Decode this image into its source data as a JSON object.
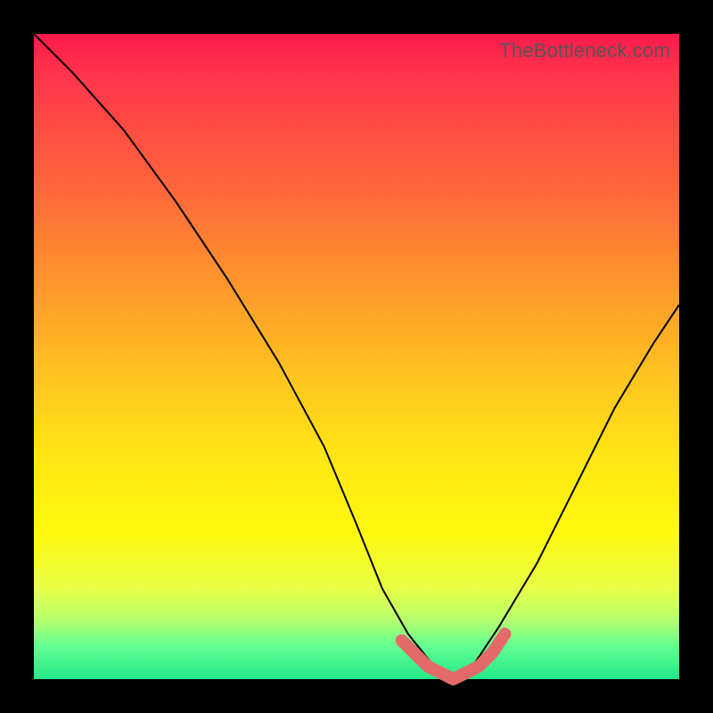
{
  "watermark": "TheBottleneck.com",
  "colors": {
    "background": "#000000",
    "curve": "#000000",
    "marker": "#e46a6a",
    "gradient_top": "#ff1a4d",
    "gradient_bottom": "#24e88a"
  },
  "chart_data": {
    "type": "line",
    "title": "",
    "xlabel": "",
    "ylabel": "",
    "xlim": [
      0,
      100
    ],
    "ylim": [
      0,
      100
    ],
    "series": [
      {
        "name": "bottleneck-curve",
        "x": [
          0,
          6,
          14,
          22,
          30,
          38,
          45,
          50,
          54,
          58,
          62,
          65,
          68,
          72,
          78,
          84,
          90,
          96,
          100
        ],
        "y": [
          100,
          94,
          85,
          74,
          62,
          49,
          36,
          24,
          14,
          7,
          2,
          0,
          2,
          8,
          18,
          30,
          42,
          52,
          58
        ]
      }
    ],
    "markers": {
      "name": "highlight-band",
      "x": [
        57,
        59,
        61,
        63,
        65,
        67,
        69,
        71,
        73
      ],
      "y": [
        6,
        4,
        2,
        1,
        0,
        1,
        2,
        4,
        7
      ]
    },
    "notes": "Axes are unmarked in the source image; values are normalized 0–100. Curve descends steeply from top-left, reaches a flat minimum around x≈65, then rises toward the right edge at roughly half height. A salmon-pink marker band highlights the flat bottom of the curve."
  }
}
